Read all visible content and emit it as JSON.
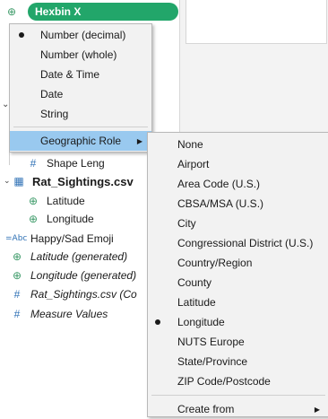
{
  "pane": {
    "pill_label": "Hexbin X",
    "fields": [
      {
        "label": "Shape Leng",
        "icon": "hash-icon"
      },
      {
        "label": "Rat_Sightings.csv",
        "icon": "table-icon"
      },
      {
        "label": "Latitude",
        "icon": "globe-icon"
      },
      {
        "label": "Longitude",
        "icon": "globe-icon"
      },
      {
        "label": "Happy/Sad Emoji",
        "icon": "abc-icon",
        "icon_text": "=Abc"
      },
      {
        "label": "Latitude (generated)",
        "icon": "globe-icon"
      },
      {
        "label": "Longitude (generated)",
        "icon": "globe-icon"
      },
      {
        "label": "Rat_Sightings.csv (Co",
        "icon": "hash-icon"
      },
      {
        "label": "Measure Values",
        "icon": "hash-icon"
      }
    ]
  },
  "menu_datatype": {
    "items": [
      "Number (decimal)",
      "Number (whole)",
      "Date & Time",
      "Date",
      "String"
    ],
    "selected": "Number (decimal)",
    "submenu_label": "Geographic Role"
  },
  "menu_geo": {
    "items": [
      "None",
      "Airport",
      "Area Code (U.S.)",
      "CBSA/MSA (U.S.)",
      "City",
      "Congressional District (U.S.)",
      "Country/Region",
      "County",
      "Latitude",
      "Longitude",
      "NUTS Europe",
      "State/Province",
      "ZIP Code/Postcode"
    ],
    "selected": "Longitude",
    "create_from": "Create from"
  },
  "colors": {
    "pill": "#22a66a",
    "highlight": "#99c9ef",
    "geo_icon": "#3c9a68",
    "measure_icon": "#2f71b5"
  }
}
